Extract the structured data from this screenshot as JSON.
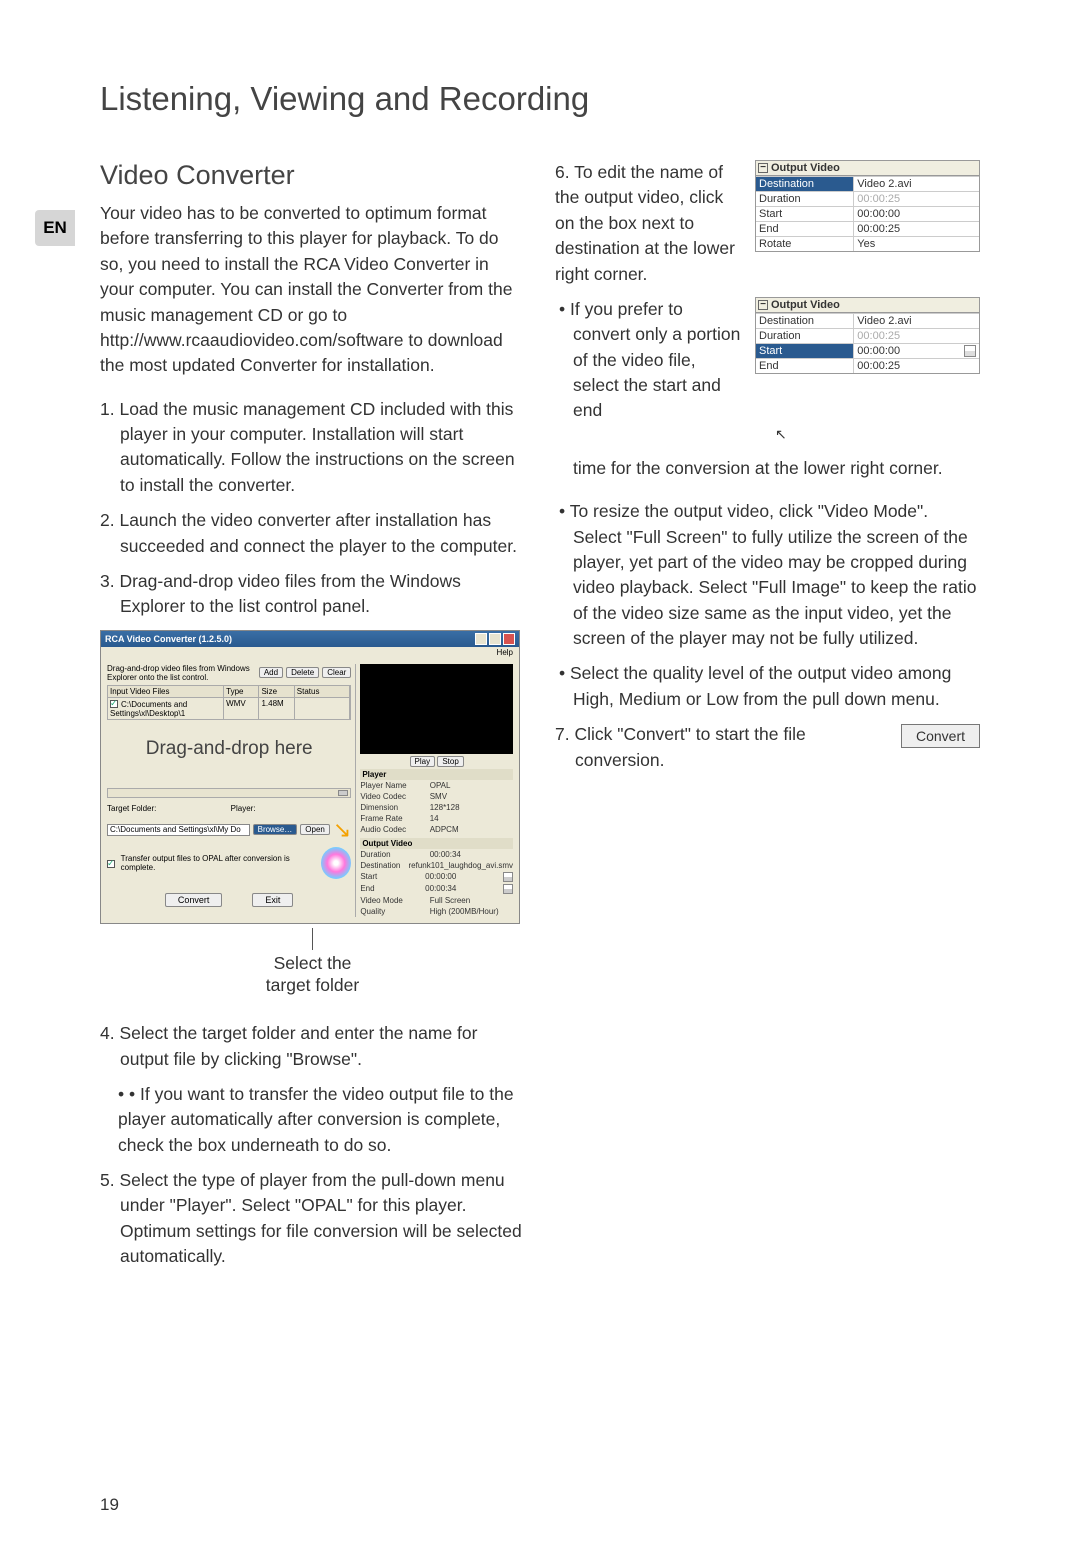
{
  "page": {
    "title": "Listening, Viewing and Recording",
    "lang_tab": "EN",
    "page_number": "19"
  },
  "left": {
    "section_title": "Video Converter",
    "intro": "Your video has to be converted to optimum format before transferring to this player for playback. To do so, you need to install the RCA Video Converter in your computer. You can install the Converter from the music management CD or go to http://www.rcaaudiovideo.com/software to download the most updated Converter for installation.",
    "steps_a": [
      "1. Load the music management CD included with this player in your computer. Installation will start automatically. Follow the instructions on the screen to install the converter.",
      "2. Launch the video converter after installation has succeeded and connect the player to the computer.",
      "3. Drag-and-drop video files from the Windows Explorer to the list control panel."
    ],
    "screenshot": {
      "window_title": "RCA Video Converter (1.2.5.0)",
      "menu_help": "Help",
      "hint": "Drag-and-drop video files from Windows Explorer onto the list control.",
      "btn_add": "Add",
      "btn_delete": "Delete",
      "btn_clear": "Clear",
      "col_input": "Input Video Files",
      "col_type": "Type",
      "col_size": "Size",
      "col_status": "Status",
      "row_file": "C:\\Documents and Settings\\xl\\Desktop\\1",
      "row_type": "WMV",
      "row_size": "1.48M",
      "drag_label": "Drag-and-drop here",
      "target_folder_lbl": "Target Folder:",
      "target_path": "C:\\Documents and Settings\\xl\\My Do",
      "btn_browse": "Browse…",
      "btn_open": "Open",
      "player_lbl": "Player:",
      "transfer_chk": "Transfer output files to OPAL after conversion is complete.",
      "btn_convert": "Convert",
      "btn_exit": "Exit",
      "btn_play": "Play",
      "btn_stop": "Stop",
      "sec_player": "Player",
      "info_player_name_l": "Player Name",
      "info_player_name_v": "OPAL",
      "info_video_codec_l": "Video Codec",
      "info_video_codec_v": "SMV",
      "info_dimension_l": "Dimension",
      "info_dimension_v": "128*128",
      "info_frame_rate_l": "Frame Rate",
      "info_frame_rate_v": "14",
      "info_audio_codec_l": "Audio Codec",
      "info_audio_codec_v": "ADPCM",
      "sec_output": "Output Video",
      "ov_duration_l": "Duration",
      "ov_duration_v": "00:00:34",
      "ov_destination_l": "Destination",
      "ov_destination_v": "refunk101_laughdog_avi.smv",
      "ov_start_l": "Start",
      "ov_start_v": "00:00:00",
      "ov_end_l": "End",
      "ov_end_v": "00:00:34",
      "ov_video_mode_l": "Video Mode",
      "ov_video_mode_v": "Full Screen",
      "ov_quality_l": "Quality",
      "ov_quality_v": "High (200MB/Hour)"
    },
    "caption": "Select the\ntarget folder",
    "steps_b": [
      "4. Select the target folder and enter the name for output file by clicking \"Browse\".",
      "• If you want to transfer the video output file to the player automatically after conversion is complete, check the box underneath to do so.",
      "5. Select the type of player from the pull-down menu under \"Player\". Select \"OPAL\" for this player. Optimum settings for file conversion will be selected automatically."
    ]
  },
  "right": {
    "step6_text": "6. To edit the name of the output video, click on the box next to destination at the lower right corner.",
    "ov_table1": {
      "header": "Output Video",
      "rows": [
        {
          "l": "Destination",
          "r": "Video 2.avi",
          "sel": true
        },
        {
          "l": "Duration",
          "r": "00:00:25",
          "dim": true
        },
        {
          "l": "Start",
          "r": "00:00:00"
        },
        {
          "l": "End",
          "r": "00:00:25"
        },
        {
          "l": "Rotate",
          "r": "Yes"
        }
      ]
    },
    "bullet_portion": "If you prefer to convert only a portion of the video file, select the start and end",
    "ov_table2": {
      "header": "Output Video",
      "rows": [
        {
          "l": "Destination",
          "r": "Video 2.avi"
        },
        {
          "l": "Duration",
          "r": "00:00:25",
          "dim": true
        },
        {
          "l": "Start",
          "r": "00:00:00",
          "sel": true,
          "spin": true
        },
        {
          "l": "End",
          "r": "00:00:25"
        }
      ]
    },
    "portion_cont": "time for the conversion at the lower right corner.",
    "bullet_resize": "To resize the output video, click \"Video Mode\". Select \"Full Screen\" to fully utilize the screen of the player, yet part of the video may be cropped during video playback. Select \"Full Image\" to keep the ratio of the video size same as the input video, yet the screen of the player may not be fully utilized.",
    "bullet_quality": "Select the quality level of the output video among High, Medium or Low from the pull down menu.",
    "step7_text": "7. Click \"Convert\" to start the file conversion.",
    "convert_btn": "Convert"
  }
}
